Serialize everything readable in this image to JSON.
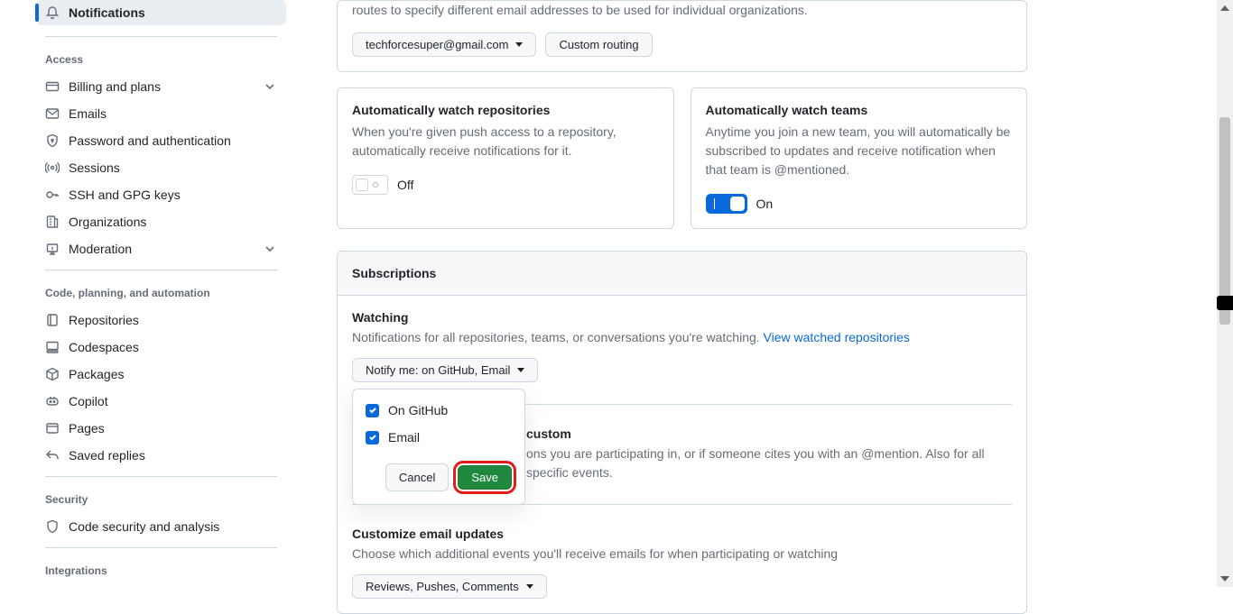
{
  "sidebar": {
    "active": "Notifications",
    "groups": [
      {
        "heading": "Access",
        "items": [
          {
            "label": "Billing and plans",
            "expandable": true
          },
          {
            "label": "Emails"
          },
          {
            "label": "Password and authentication"
          },
          {
            "label": "Sessions"
          },
          {
            "label": "SSH and GPG keys"
          },
          {
            "label": "Organizations"
          },
          {
            "label": "Moderation",
            "expandable": true
          }
        ]
      },
      {
        "heading": "Code, planning, and automation",
        "items": [
          {
            "label": "Repositories"
          },
          {
            "label": "Codespaces"
          },
          {
            "label": "Packages"
          },
          {
            "label": "Copilot"
          },
          {
            "label": "Pages"
          },
          {
            "label": "Saved replies"
          }
        ]
      },
      {
        "heading": "Security",
        "items": [
          {
            "label": "Code security and analysis"
          }
        ]
      },
      {
        "heading": "Integrations",
        "items": []
      }
    ]
  },
  "email_routing": {
    "description": "routes to specify different email addresses to be used for individual organizations.",
    "default_email": "techforcesuper@gmail.com",
    "custom_routing_label": "Custom routing"
  },
  "auto_watch_repos": {
    "title": "Automatically watch repositories",
    "desc": "When you're given push access to a repository, automatically receive notifications for it.",
    "state_label": "Off"
  },
  "auto_watch_teams": {
    "title": "Automatically watch teams",
    "desc": "Anytime you join a new team, you will automatically be subscribed to updates and receive notification when that team is @mentioned.",
    "state_label": "On"
  },
  "subscriptions": {
    "panel_title": "Subscriptions",
    "watching": {
      "title": "Watching",
      "desc_pre": "Notifications for all repositories, teams, or conversations you're watching. ",
      "link": "View watched repositories",
      "notify_button": "Notify me: on GitHub, Email",
      "options": [
        {
          "label": "On GitHub",
          "checked": true
        },
        {
          "label": "Email",
          "checked": true
        }
      ],
      "cancel": "Cancel",
      "save": "Save"
    },
    "participating": {
      "title_suffix": "custom",
      "desc": "ons you are participating in, or if someone cites you with an @mention. Also for all specific events.",
      "desc_line2": "pecific events."
    },
    "customize": {
      "title": "Customize email updates",
      "desc": "Choose which additional events you'll receive emails for when participating or watching",
      "button": "Reviews, Pushes, Comments"
    }
  }
}
